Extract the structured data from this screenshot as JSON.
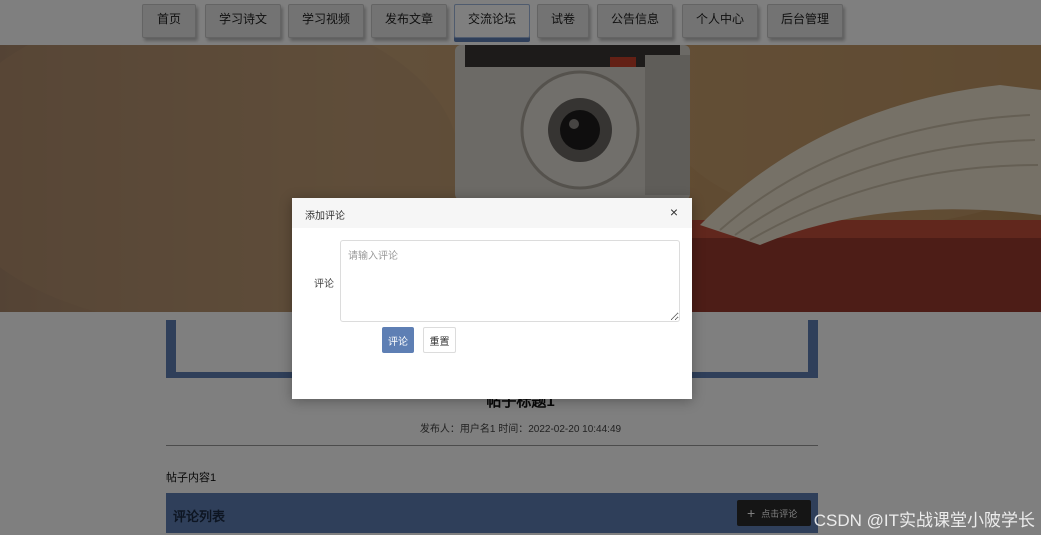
{
  "nav": {
    "items": [
      {
        "label": "首页"
      },
      {
        "label": "学习诗文"
      },
      {
        "label": "学习视频"
      },
      {
        "label": "发布文章"
      },
      {
        "label": "交流论坛"
      },
      {
        "label": "试卷"
      },
      {
        "label": "公告信息"
      },
      {
        "label": "个人中心"
      },
      {
        "label": "后台管理"
      }
    ],
    "active_label": "交流论坛"
  },
  "post": {
    "title": "帖子标题1",
    "meta": "发布人：用户名1 时间：2022-02-20 10:44:49",
    "content": "帖子内容1"
  },
  "comments": {
    "section_title": "评论列表",
    "add_button_label": "点击评论"
  },
  "dialog": {
    "title": "添加评论",
    "close_icon": "×",
    "field_label": "评论",
    "textarea_placeholder": "请输入评论",
    "submit_label": "评论",
    "reset_label": "重置"
  },
  "watermark": "CSDN @IT实战课堂小陂学长",
  "colors": {
    "accent": "#5e7fb4",
    "overlay": "rgba(0,0,0,0.5)"
  }
}
